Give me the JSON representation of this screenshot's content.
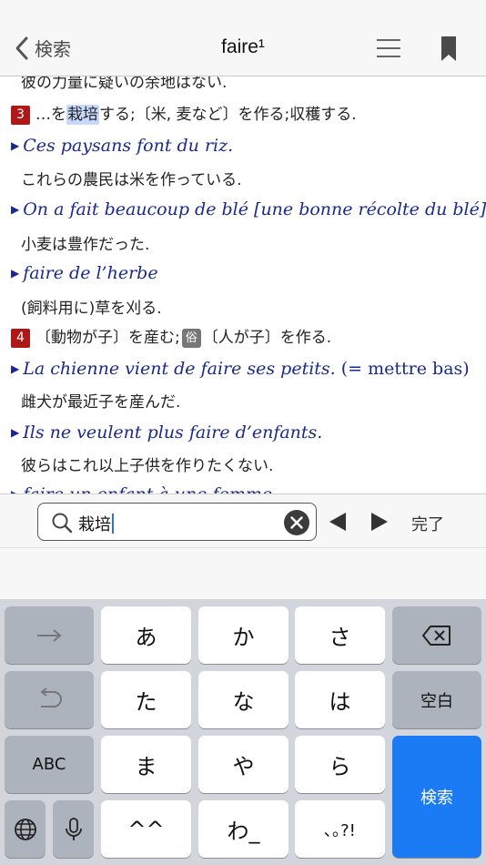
{
  "nav": {
    "back_label": "検索",
    "title": "faire¹",
    "icons": [
      "chevron-left-icon",
      "menu-icon",
      "bookmark-icon"
    ]
  },
  "content": {
    "line0": "彼の力量に疑いの余地はない.",
    "sense3": {
      "num": "3",
      "pre": "…を",
      "highlight": "栽培",
      "post": "する;〔米, 麦など〕を作る;収穫する."
    },
    "ex1": {
      "fr": "Ces paysans font du riz.",
      "ja": "これらの農民は米を作っている."
    },
    "ex2": {
      "fr": "On a fait beaucoup de blé [une bonne récolte du blé].",
      "ja": "小麦は豊作だった."
    },
    "ex3": {
      "fr": "faire de l’herbe",
      "ja": "(飼料用に)草を刈る."
    },
    "sense4": {
      "num": "4",
      "pre": "〔動物が子〕を産む;",
      "tag": "俗",
      "post": "〔人が子〕を作る."
    },
    "ex4": {
      "fr": "La chienne vient de faire ses petits.",
      "fr_note": " (= mettre bas)",
      "ja": "雌犬が最近子を産んだ."
    },
    "ex5": {
      "fr": "Ils ne veulent plus faire d’enfants.",
      "ja": "彼らはこれ以上子供を作りたくない."
    },
    "ex6_partial": "faire un enfant à une femme"
  },
  "search": {
    "value": "栽培",
    "done_label": "完了",
    "icons": [
      "search-icon",
      "clear-icon",
      "previous-icon",
      "next-icon"
    ]
  },
  "keyboard": {
    "row1": [
      "→",
      "あ",
      "か",
      "さ",
      "⌫"
    ],
    "row2": [
      "↺",
      "た",
      "な",
      "は",
      "空白"
    ],
    "row3": [
      "ABC",
      "ま",
      "や",
      "ら"
    ],
    "row4": [
      "🌐",
      "🎤",
      "^^",
      "わ_",
      "､｡?!"
    ],
    "search_key": "検索",
    "colors": {
      "accent": "#1a7bf5",
      "bg": "#d2d5db",
      "dark_key": "#adb3bd"
    }
  }
}
